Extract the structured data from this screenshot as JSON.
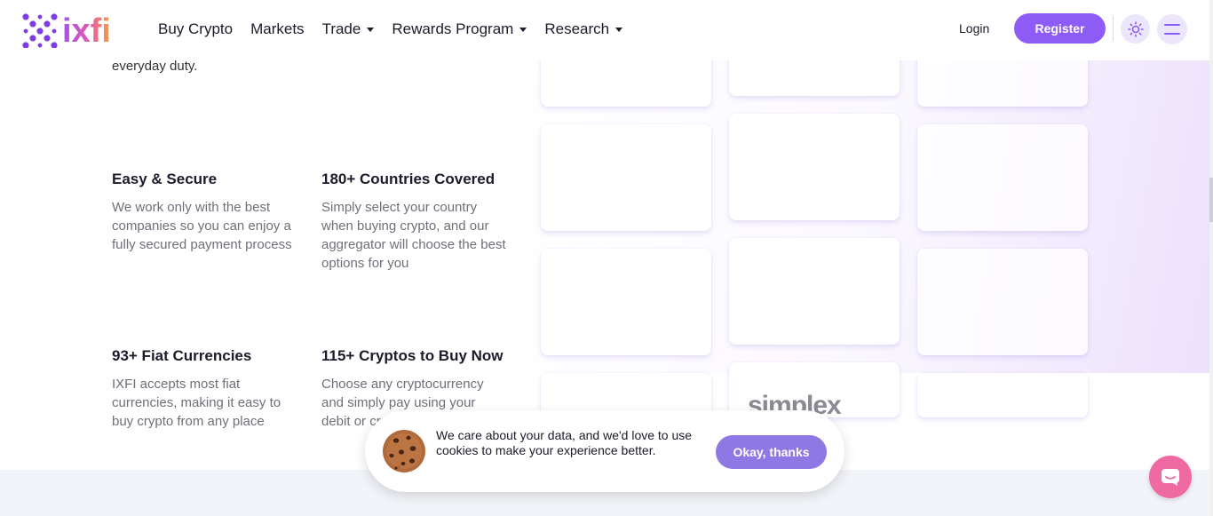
{
  "header": {
    "logo_text": "ixfi",
    "nav": [
      {
        "label": "Buy Crypto",
        "has_dropdown": false
      },
      {
        "label": "Markets",
        "has_dropdown": false
      },
      {
        "label": "Trade",
        "has_dropdown": true
      },
      {
        "label": "Rewards Program",
        "has_dropdown": true
      },
      {
        "label": "Research",
        "has_dropdown": true
      }
    ],
    "login_label": "Login",
    "register_label": "Register",
    "theme_icon": "sun-icon",
    "menu_icon": "hamburger-icon"
  },
  "features": {
    "trailing_text": "everyday duty.",
    "items": [
      {
        "title": "Easy & Secure",
        "description": "We work only with the best companies so you can enjoy a fully secured payment process"
      },
      {
        "title": "180+ Countries Covered",
        "description": "Simply select your country when buying crypto, and our aggregator will choose the best options for you"
      },
      {
        "title": "93+ Fiat Currencies",
        "description": "IXFI accepts most fiat currencies, making it easy to buy crypto from any place"
      },
      {
        "title": "115+ Cryptos to Buy Now",
        "description": "Choose any cryptocurrency and simply pay using your debit or cr"
      }
    ]
  },
  "providers": {
    "visible_logo": "simplex"
  },
  "cookie_banner": {
    "message": "We care about your data, and we'd love to use cookies to make your experience better.",
    "accept_label": "Okay, thanks",
    "icon": "cookie-icon"
  },
  "chat": {
    "icon": "chat-icon"
  },
  "colors": {
    "brand_purple": "#8d5cf6",
    "cookie_button": "#8e78e4",
    "chat_pink": "#ef6aa2"
  }
}
